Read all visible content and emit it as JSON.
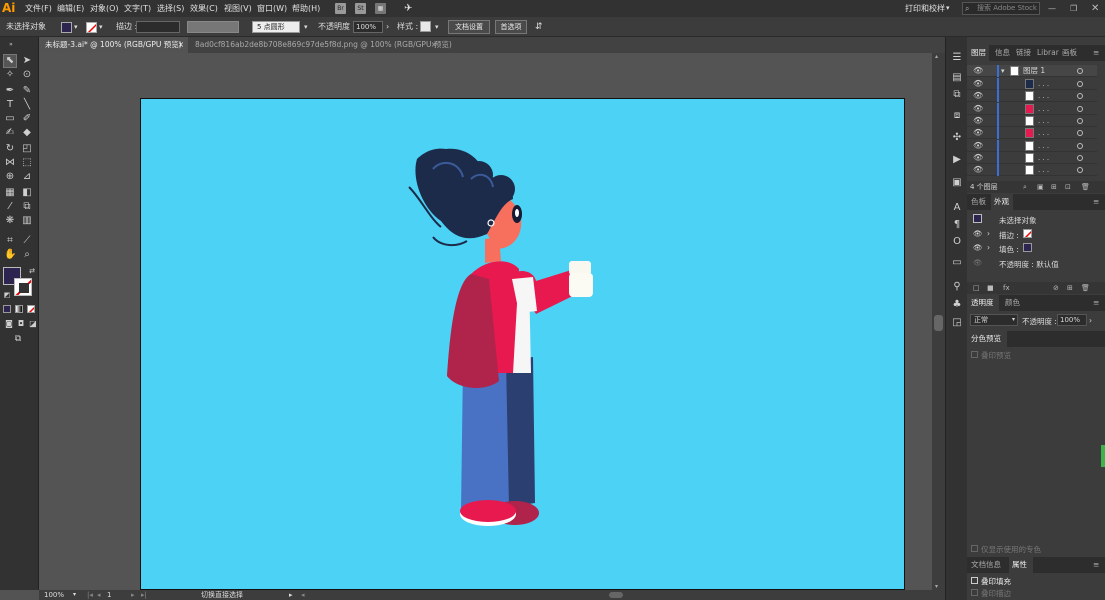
{
  "menubar": {
    "logo": "Ai",
    "items": [
      "文件(F)",
      "编辑(E)",
      "对象(O)",
      "文字(T)",
      "选择(S)",
      "效果(C)",
      "视图(V)",
      "窗口(W)",
      "帮助(H)"
    ],
    "badges": [
      "Br",
      "St"
    ],
    "print_tile": "打印和校样",
    "search_placeholder": "搜索 Adobe Stock"
  },
  "controlbar": {
    "no_selection": "未选择对象",
    "stroke_label": "描边 :",
    "brush_value": "5 点圆形",
    "opacity_label": "不透明度 :",
    "opacity_value": "100%",
    "style_label": "样式 :",
    "doc_setup": "文档设置",
    "preferences": "首选项"
  },
  "tabs": [
    {
      "label": "未标题-3.ai* @ 100% (RGB/GPU 预览)",
      "close": "×"
    },
    {
      "label": "8ad0cf816ab2de8b708e869c97de5f8d.png @ 100% (RGB/GPU 预览)",
      "close": "×"
    }
  ],
  "statusbar": {
    "zoom": "100%",
    "page": "1",
    "tool_hint": "切换直接选择"
  },
  "layers_panel": {
    "tabs": [
      "图层",
      "信息",
      "链接",
      "Librar",
      "画板"
    ],
    "layer_name": "图层 1",
    "sublayer_label": ". . .",
    "sublayer_count": 8,
    "footer_count": "4 个图层"
  },
  "appearance_panel": {
    "tabs": [
      "色板",
      "外观"
    ],
    "title": "未选择对象",
    "stroke": "描边 :",
    "fill": "填色 :",
    "opacity": "不透明度 : 默认值"
  },
  "transparency_panel": {
    "tabs": [
      "透明度",
      "颜色"
    ],
    "mode": "正常",
    "opacity_label": "不透明度 :",
    "opacity_value": "100%"
  },
  "separations_panel": {
    "title": "分色预览",
    "overprint_preview": "叠印预览",
    "spot_only": "仅显示使用的专色"
  },
  "attributes_panel": {
    "tabs": [
      "文档信息",
      "属性"
    ],
    "overprint_fill": "叠印填充",
    "overprint_stroke": "叠印描边"
  },
  "colors": {
    "artboard": "#4bd2f5",
    "jacket": "#e8194f",
    "backpack": "#b0234b",
    "pants_light": "#4a72c4",
    "pants_dark": "#2b3f70",
    "hair": "#1d2b4b",
    "skin": "#f7705e",
    "fill_swatch": "#2d2550"
  }
}
